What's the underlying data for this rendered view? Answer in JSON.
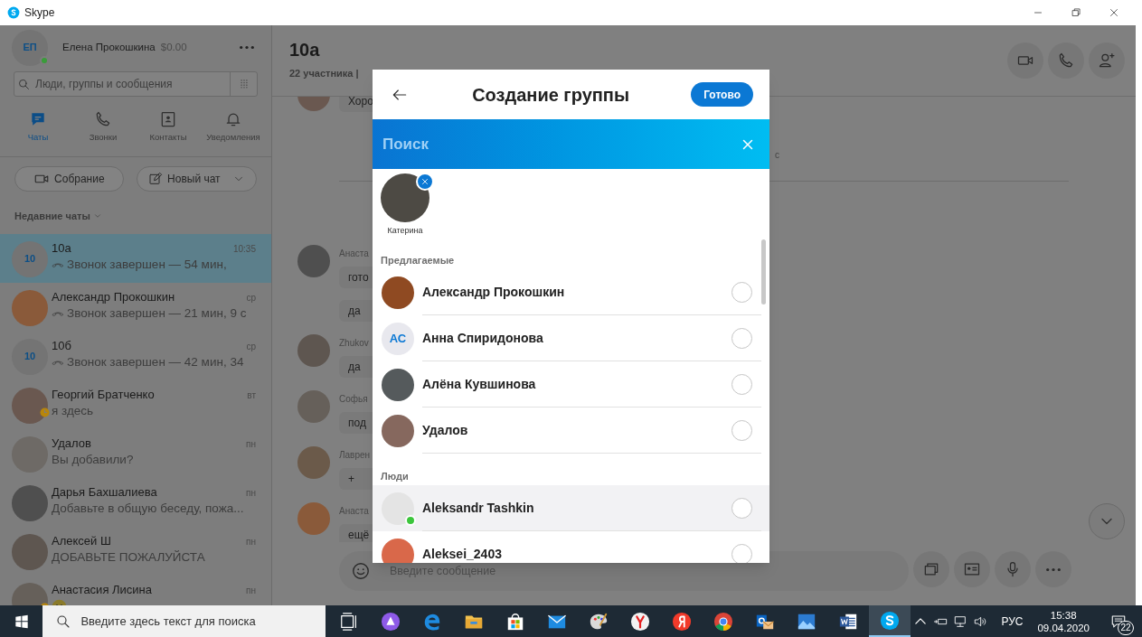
{
  "window": {
    "title": "Skype"
  },
  "profile": {
    "initials": "ЕП",
    "name": "Елена Прокошкина",
    "balance": "$0.00",
    "online": true
  },
  "sidebar_search": {
    "placeholder": "Люди, группы и сообщения"
  },
  "nav_tabs": [
    {
      "kind": "chats",
      "label": "Чаты",
      "selected": true
    },
    {
      "kind": "calls",
      "label": "Звонки",
      "selected": false
    },
    {
      "kind": "contacts",
      "label": "Контакты",
      "selected": false
    },
    {
      "kind": "notifications",
      "label": "Уведомления",
      "selected": false
    }
  ],
  "actions": [
    {
      "kind": "meeting",
      "label": "Собрание"
    },
    {
      "kind": "new_chat",
      "label": "Новый чат"
    }
  ],
  "recent_header": "Недавние чаты",
  "chats": [
    {
      "kind": "call",
      "name": "10а",
      "time": "10:35",
      "preview": "Звонок завершен — 54 мин,",
      "avatar": "10",
      "selected": true,
      "away": false
    },
    {
      "kind": "call",
      "name": "Александр Прокошкин",
      "time": "ср",
      "preview": "Звонок завершен — 21 мин, 9 с",
      "selected": false,
      "away": false
    },
    {
      "kind": "call",
      "name": "10б",
      "time": "ср",
      "preview": "Звонок завершен — 42 мин, 34",
      "avatar": "10",
      "selected": false,
      "away": false
    },
    {
      "kind": "message",
      "name": "Георгий Братченко",
      "time": "вт",
      "preview": "я здесь",
      "selected": false,
      "away": true
    },
    {
      "kind": "message",
      "name": "Удалов",
      "time": "пн",
      "preview": "Вы добавили?",
      "selected": false,
      "away": false
    },
    {
      "kind": "message",
      "name": "Дарья Бахшалиева",
      "time": "пн",
      "preview": "Добавьте в общую беседу, пожа...",
      "selected": false,
      "away": false
    },
    {
      "kind": "message",
      "name": "Алексей Ш",
      "time": "пн",
      "preview": "ДОБАВЬТЕ ПОЖАЛУЙСТА",
      "selected": false,
      "away": false
    },
    {
      "kind": "emoji",
      "name": "Анастасия Лисина",
      "time": "пн",
      "selected": false,
      "away": true
    }
  ],
  "conversation": {
    "title": "10а",
    "subtitle": "22 участника |",
    "messages": [
      {
        "kind": "group",
        "bubbles": [
          "Хоро"
        ]
      },
      {
        "kind": "event",
        "text": "с"
      },
      {
        "kind": "group",
        "author": "Анаста",
        "bubbles": [
          "гото",
          "да"
        ]
      },
      {
        "kind": "group",
        "author": "Zhukov",
        "bubbles": [
          "да"
        ]
      },
      {
        "kind": "group",
        "author": "Софья",
        "bubbles": [
          "под"
        ]
      },
      {
        "kind": "group",
        "author": "Лаврен",
        "bubbles": [
          "+"
        ]
      },
      {
        "kind": "group",
        "author": "Анаста",
        "bubbles": [
          "ещё"
        ]
      }
    ],
    "composer": {
      "placeholder": "Введите сообщение"
    }
  },
  "modal": {
    "title": "Создание группы",
    "done_label": "Готово",
    "search_placeholder": "Поиск",
    "selected_contacts": [
      {
        "name": "Катерина"
      }
    ],
    "sections": [
      {
        "title": "Предлагаемые",
        "contacts": [
          {
            "name": "Александр Прокошкин",
            "checked": false,
            "online": false,
            "hovered": false
          },
          {
            "name": "Анна Спиридонова",
            "initials": "АС",
            "checked": false,
            "online": false,
            "hovered": false
          },
          {
            "name": "Алёна Кувшинова",
            "checked": false,
            "online": false,
            "hovered": false
          },
          {
            "name": "Удалов",
            "checked": false,
            "online": false,
            "hovered": false
          }
        ]
      },
      {
        "title": "Люди",
        "contacts": [
          {
            "name": "Aleksandr Tashkin",
            "checked": false,
            "online": true,
            "hovered": true
          },
          {
            "name": "Aleksei_2403",
            "checked": false,
            "online": false,
            "hovered": false
          }
        ]
      }
    ]
  },
  "taskbar": {
    "search_placeholder": "Введите здесь текст для поиска",
    "apps": [
      {
        "kind": "taskview",
        "active": false
      },
      {
        "kind": "assistant",
        "active": false
      },
      {
        "kind": "edge",
        "active": false
      },
      {
        "kind": "files",
        "active": false
      },
      {
        "kind": "store",
        "active": false
      },
      {
        "kind": "mail",
        "active": false
      },
      {
        "kind": "paint",
        "active": false
      },
      {
        "kind": "ybrowser",
        "active": false
      },
      {
        "kind": "yandex",
        "active": false
      },
      {
        "kind": "chrome",
        "active": false
      },
      {
        "kind": "outlook",
        "active": false
      },
      {
        "kind": "photos",
        "active": false
      },
      {
        "kind": "word",
        "active": false
      },
      {
        "kind": "skype",
        "active": true
      }
    ],
    "language": "РУС",
    "time": "15:38",
    "date": "09.04.2020",
    "notification_count": "22"
  }
}
